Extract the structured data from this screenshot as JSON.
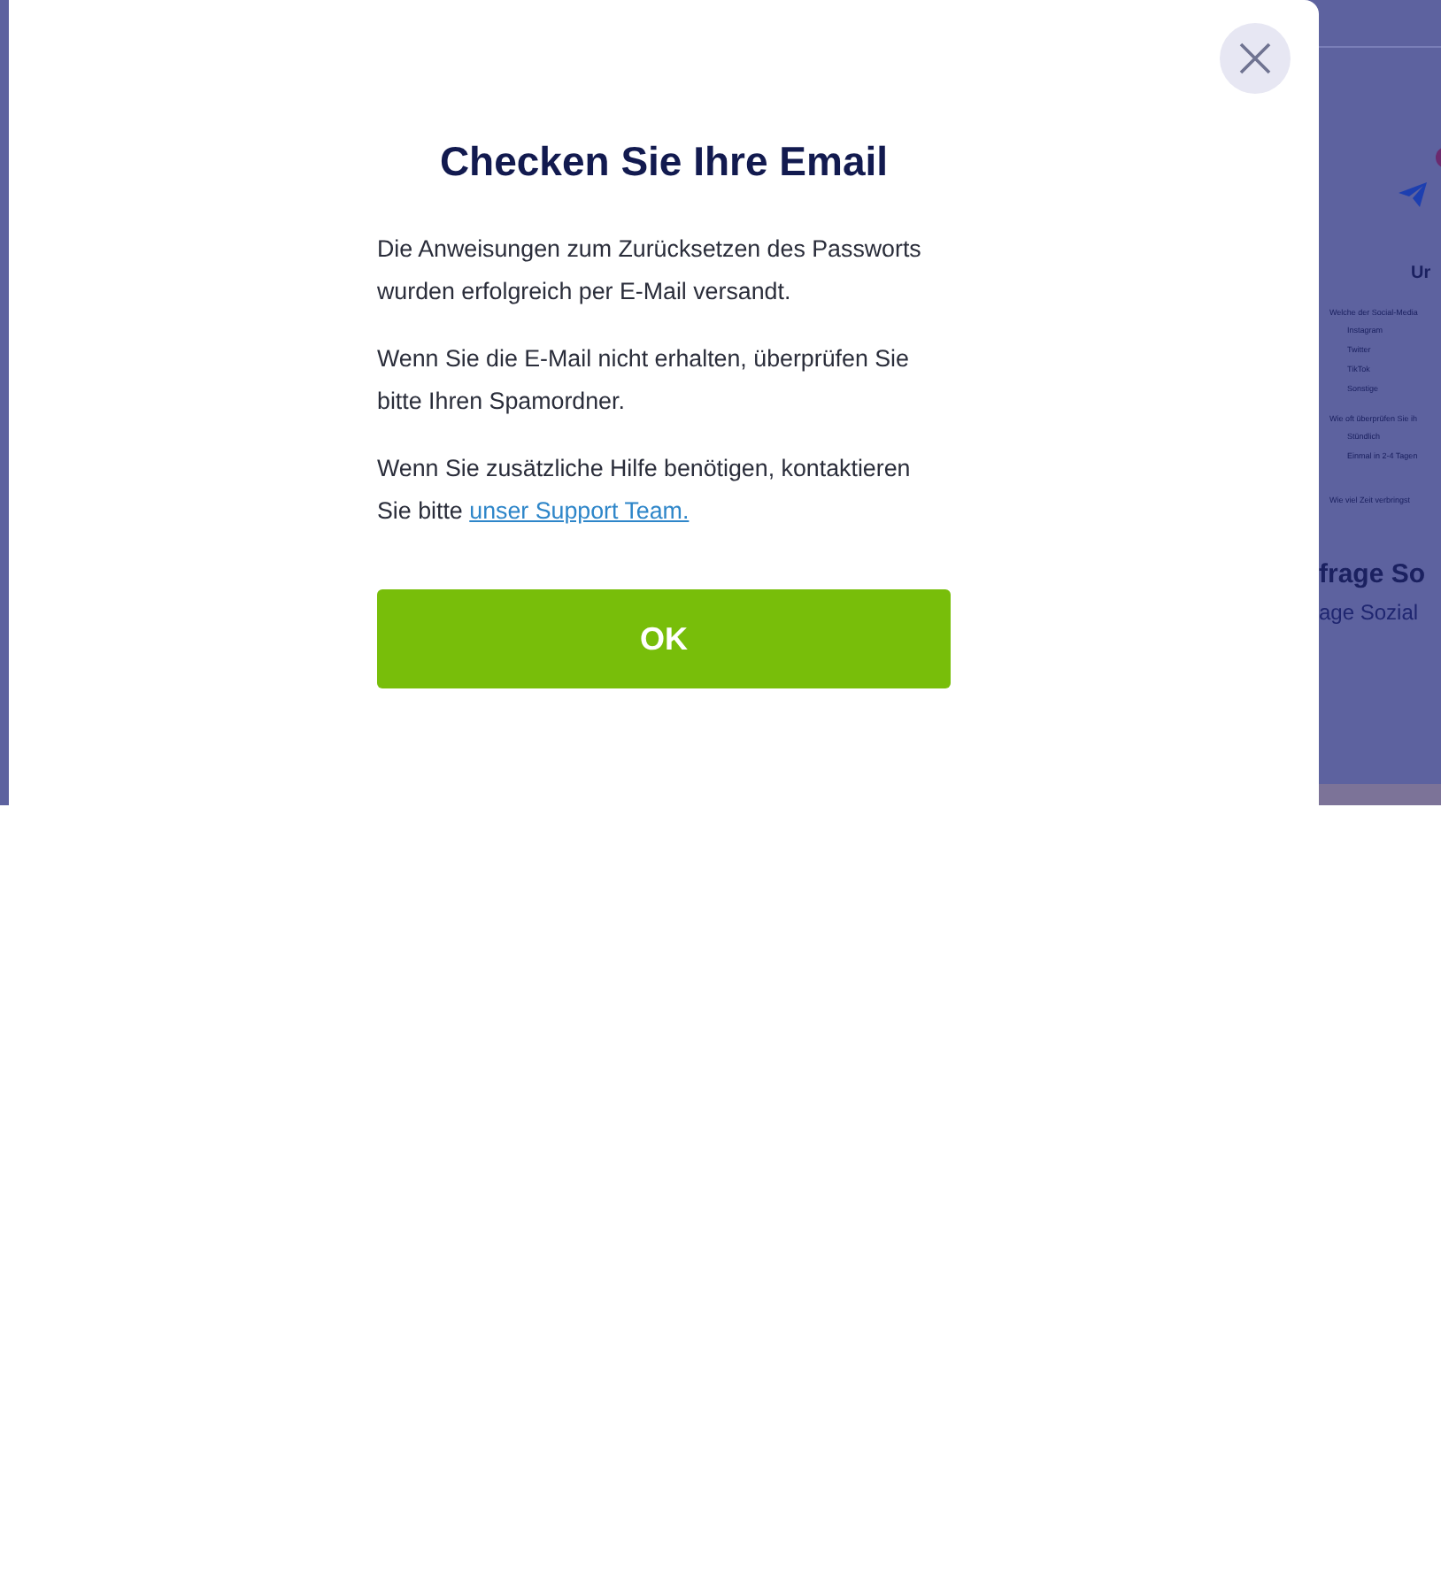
{
  "background_page": {
    "heading": "Ur",
    "question_1": "Welche der Social-Media",
    "options_1": [
      "Instagram",
      "Twitter",
      "TikTok",
      "Sonstige"
    ],
    "question_2": "Wie oft überprüfen Sie ih",
    "options_2": [
      "Stündlich",
      "Einmal in 2-4 Tagen"
    ],
    "question_3": "Wie viel Zeit verbringst",
    "title": "frage So",
    "subtitle": "age Sozial"
  },
  "dialog": {
    "title": "Checken Sie Ihre Email",
    "paragraphs": [
      {
        "text": "Die Anweisungen zum Zurücksetzen des Passworts wurden erfolgreich per E-Mail versandt."
      },
      {
        "text": "Wenn Sie die E-Mail nicht erhalten, überprüfen Sie bitte Ihren Spamordner."
      },
      {
        "text": "Wenn Sie zusätzliche Hilfe benötigen, kontaktieren Sie bitte",
        "link": "unser Support Team."
      }
    ],
    "button": "OK"
  }
}
